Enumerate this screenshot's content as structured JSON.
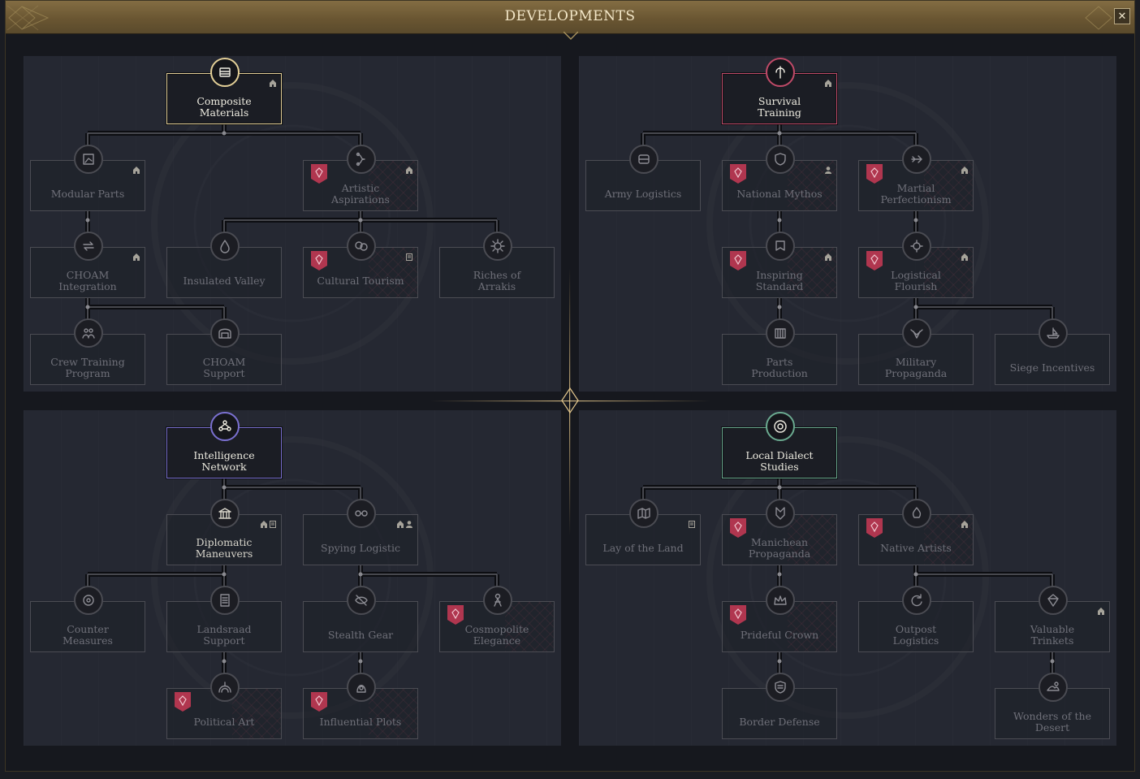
{
  "window": {
    "title": "DEVELOPMENTS",
    "close_label": "✕"
  },
  "accents": {
    "economic": "#e3cf97",
    "military": "#c04a68",
    "espionage": "#7a70d0",
    "statecraft": "#6aa98f",
    "flag": "#b0364f"
  },
  "quadrants": [
    {
      "id": "economic",
      "nodes": [
        {
          "key": "composite-materials",
          "label": "Composite Materials",
          "lines": [
            "Composite",
            "Materials"
          ],
          "icon": "crate-icon",
          "state": "root",
          "badges": [
            "house"
          ]
        },
        {
          "key": "modular-parts",
          "label": "Modular Parts",
          "lines": [
            "Modular Parts"
          ],
          "icon": "blueprint-icon",
          "state": "locked",
          "badges": [
            "house"
          ]
        },
        {
          "key": "artistic-aspirations",
          "label": "Artistic Aspirations",
          "lines": [
            "Artistic",
            "Aspirations"
          ],
          "icon": "scroll-art-icon",
          "state": "locked",
          "badges": [
            "house"
          ],
          "flag": true
        },
        {
          "key": "choam-integration",
          "label": "CHOAM Integration",
          "lines": [
            "CHOAM",
            "Integration"
          ],
          "icon": "exchange-icon",
          "state": "locked",
          "badges": [
            "house"
          ]
        },
        {
          "key": "insulated-valley",
          "label": "Insulated Valley",
          "lines": [
            "Insulated Valley"
          ],
          "icon": "droplet-icon",
          "state": "locked",
          "badges": []
        },
        {
          "key": "cultural-tourism",
          "label": "Cultural Tourism",
          "lines": [
            "Cultural Tourism"
          ],
          "icon": "masks-icon",
          "state": "locked",
          "badges": [
            "doc"
          ],
          "flag": true
        },
        {
          "key": "riches-of-arrakis",
          "label": "Riches of Arrakis",
          "lines": [
            "Riches of",
            "Arrakis"
          ],
          "icon": "sun-gear-icon",
          "state": "locked",
          "badges": []
        },
        {
          "key": "crew-training-program",
          "label": "Crew Training Program",
          "lines": [
            "Crew Training",
            "Program"
          ],
          "icon": "crew-icon",
          "state": "locked",
          "badges": []
        },
        {
          "key": "choam-support",
          "label": "CHOAM Support",
          "lines": [
            "CHOAM",
            "Support"
          ],
          "icon": "hangar-icon",
          "state": "locked",
          "badges": []
        }
      ]
    },
    {
      "id": "military",
      "nodes": [
        {
          "key": "survival-training",
          "label": "Survival Training",
          "lines": [
            "Survival",
            "Training"
          ],
          "icon": "blade-icon",
          "state": "root",
          "badges": [
            "house"
          ]
        },
        {
          "key": "army-logistics",
          "label": "Army Logistics",
          "lines": [
            "Army Logistics"
          ],
          "icon": "cargo-icon",
          "state": "locked",
          "badges": []
        },
        {
          "key": "national-mythos",
          "label": "National Mythos",
          "lines": [
            "National Mythos"
          ],
          "icon": "shield-icon",
          "state": "locked",
          "badges": [
            "person"
          ],
          "flag": true
        },
        {
          "key": "martial-perfectionism",
          "label": "Martial Perfectionism",
          "lines": [
            "Martial",
            "Perfectionism"
          ],
          "icon": "arrow-icon",
          "state": "locked",
          "badges": [
            "house"
          ],
          "flag": true
        },
        {
          "key": "inspiring-standard",
          "label": "Inspiring Standard",
          "lines": [
            "Inspiring",
            "Standard"
          ],
          "icon": "banner-icon",
          "state": "locked",
          "badges": [
            "house"
          ],
          "flag": true
        },
        {
          "key": "logistical-flourish",
          "label": "Logistical Flourish",
          "lines": [
            "Logistical",
            "Flourish"
          ],
          "icon": "gear-shield-icon",
          "state": "locked",
          "badges": [
            "house"
          ],
          "flag": true
        },
        {
          "key": "parts-production",
          "label": "Parts Production",
          "lines": [
            "Parts",
            "Production"
          ],
          "icon": "factory-icon",
          "state": "locked",
          "badges": []
        },
        {
          "key": "military-propaganda",
          "label": "Military Propaganda",
          "lines": [
            "Military",
            "Propaganda"
          ],
          "icon": "eagle-icon",
          "state": "locked",
          "badges": []
        },
        {
          "key": "siege-incentives",
          "label": "Siege Incentives",
          "lines": [
            "Siege Incentives"
          ],
          "icon": "ship-icon",
          "state": "locked",
          "badges": []
        }
      ]
    },
    {
      "id": "espionage",
      "nodes": [
        {
          "key": "intelligence-network",
          "label": "Intelligence Network",
          "lines": [
            "Intelligence",
            "Network"
          ],
          "icon": "network-icon",
          "state": "root",
          "badges": []
        },
        {
          "key": "diplomatic-maneuvers",
          "label": "Diplomatic Maneuvers",
          "lines": [
            "Diplomatic",
            "Maneuvers"
          ],
          "icon": "temple-icon",
          "state": "available",
          "badges": [
            "house",
            "doc"
          ]
        },
        {
          "key": "spying-logistic",
          "label": "Spying Logistic",
          "lines": [
            "Spying Logistic"
          ],
          "icon": "goggles-icon",
          "state": "locked",
          "badges": [
            "house",
            "person"
          ]
        },
        {
          "key": "counter-measures",
          "label": "Counter Measures",
          "lines": [
            "Counter",
            "Measures"
          ],
          "icon": "target-icon",
          "state": "locked",
          "badges": []
        },
        {
          "key": "landsraad-support",
          "label": "Landsraad Support",
          "lines": [
            "Landsraad",
            "Support"
          ],
          "icon": "document-icon",
          "state": "locked",
          "badges": []
        },
        {
          "key": "stealth-gear",
          "label": "Stealth Gear",
          "lines": [
            "Stealth Gear"
          ],
          "icon": "eye-slash-icon",
          "state": "locked",
          "badges": []
        },
        {
          "key": "cosmopolite-elegance",
          "label": "Cosmopolite Elegance",
          "lines": [
            "Cosmopolite",
            "Elegance"
          ],
          "icon": "figure-icon",
          "state": "locked",
          "badges": [],
          "flag": true
        },
        {
          "key": "political-art",
          "label": "Political Art",
          "lines": [
            "Political Art"
          ],
          "icon": "arch-icon",
          "state": "locked",
          "badges": [],
          "flag": true
        },
        {
          "key": "influential-plots",
          "label": "Influential Plots",
          "lines": [
            "Influential Plots"
          ],
          "icon": "hooded-icon",
          "state": "locked",
          "badges": [],
          "flag": true
        }
      ]
    },
    {
      "id": "statecraft",
      "nodes": [
        {
          "key": "local-dialect-studies",
          "label": "Local Dialect Studies",
          "lines": [
            "Local Dialect",
            "Studies"
          ],
          "icon": "spiral-icon",
          "state": "root",
          "badges": []
        },
        {
          "key": "lay-of-the-land",
          "label": "Lay of the Land",
          "lines": [
            "Lay of the Land"
          ],
          "icon": "map-icon",
          "state": "locked",
          "badges": [
            "doc"
          ]
        },
        {
          "key": "manichean-propaganda",
          "label": "Manichean Propaganda",
          "lines": [
            "Manichean",
            "Propaganda"
          ],
          "icon": "crest-icon",
          "state": "locked",
          "badges": [],
          "flag": true
        },
        {
          "key": "native-artists",
          "label": "Native Artists",
          "lines": [
            "Native Artists"
          ],
          "icon": "flame-icon",
          "state": "locked",
          "badges": [
            "house"
          ],
          "flag": true
        },
        {
          "key": "prideful-crown",
          "label": "Prideful Crown",
          "lines": [
            "Prideful Crown"
          ],
          "icon": "crown-icon",
          "state": "locked",
          "badges": [],
          "flag": true
        },
        {
          "key": "outpost-logistics",
          "label": "Outpost Logistics",
          "lines": [
            "Outpost",
            "Logistics"
          ],
          "icon": "cycle-icon",
          "state": "locked",
          "badges": []
        },
        {
          "key": "valuable-trinkets",
          "label": "Valuable Trinkets",
          "lines": [
            "Valuable",
            "Trinkets"
          ],
          "icon": "gem-icon",
          "state": "locked",
          "badges": [
            "house"
          ]
        },
        {
          "key": "border-defense",
          "label": "Border Defense",
          "lines": [
            "Border Defense"
          ],
          "icon": "wall-shield-icon",
          "state": "locked",
          "badges": []
        },
        {
          "key": "wonders-of-the-desert",
          "label": "Wonders of the Desert",
          "lines": [
            "Wonders of the",
            "Desert"
          ],
          "icon": "dune-icon",
          "state": "locked",
          "badges": []
        }
      ]
    }
  ]
}
